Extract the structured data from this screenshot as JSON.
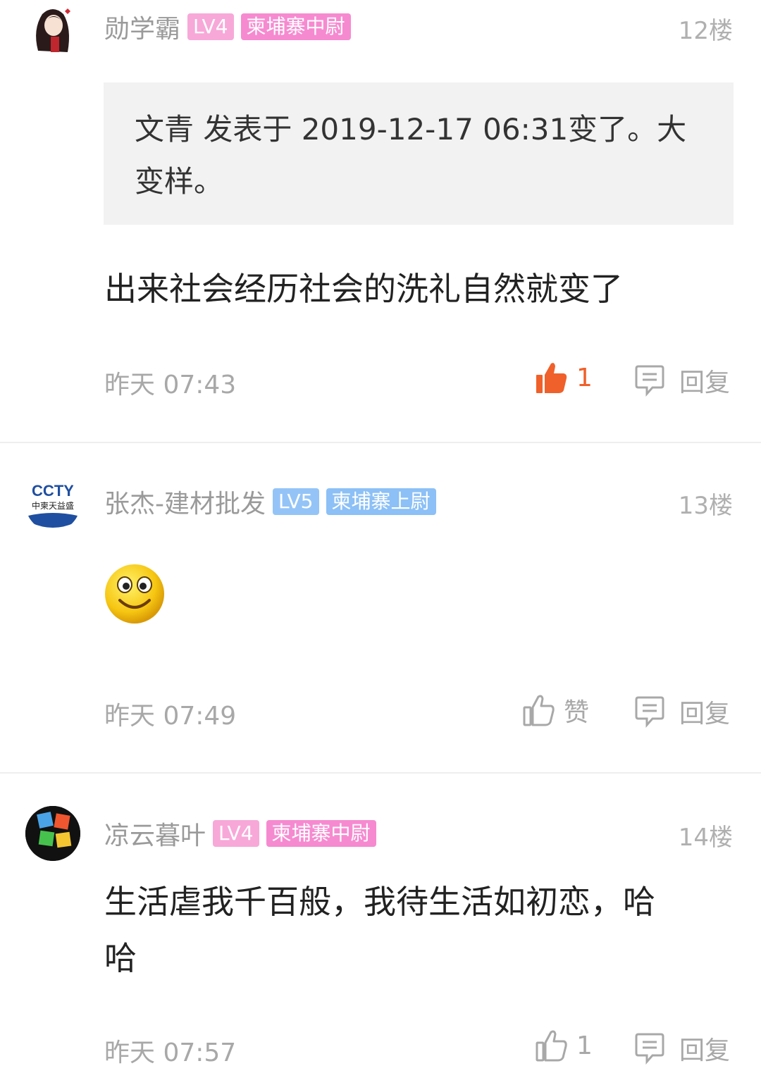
{
  "posts": [
    {
      "username": "勋学霸",
      "level": "LV4",
      "title": "柬埔寨中尉",
      "floor": "12楼",
      "quote": "文青 发表于 2019-12-17 06:31变了。大变样。",
      "content": "出来社会经历社会的洗礼自然就变了",
      "time": "昨天 07:43",
      "like_label": "1",
      "liked": true,
      "reply_label": "回复"
    },
    {
      "username": "张杰-建材批发",
      "level": "LV5",
      "title": "柬埔寨上尉",
      "floor": "13楼",
      "content": "",
      "emoji": "smile-emoji",
      "avatar_logo_text": "CCTY",
      "avatar_logo_sub": "中柬天益盛",
      "time": "昨天 07:49",
      "like_label": "赞",
      "liked": false,
      "reply_label": "回复"
    },
    {
      "username": "凉云暮叶",
      "level": "LV4",
      "title": "柬埔寨中尉",
      "floor": "14楼",
      "content": "生活虐我千百般，我待生活如初恋，哈哈",
      "time": "昨天 07:57",
      "like_label": "1",
      "liked": false,
      "reply_label": "回复"
    }
  ],
  "colors": {
    "like_active": "#f0602a",
    "badge_pink": "#f68ad0",
    "badge_blue": "#8cc0f6",
    "muted_text": "#a8a8a8"
  }
}
